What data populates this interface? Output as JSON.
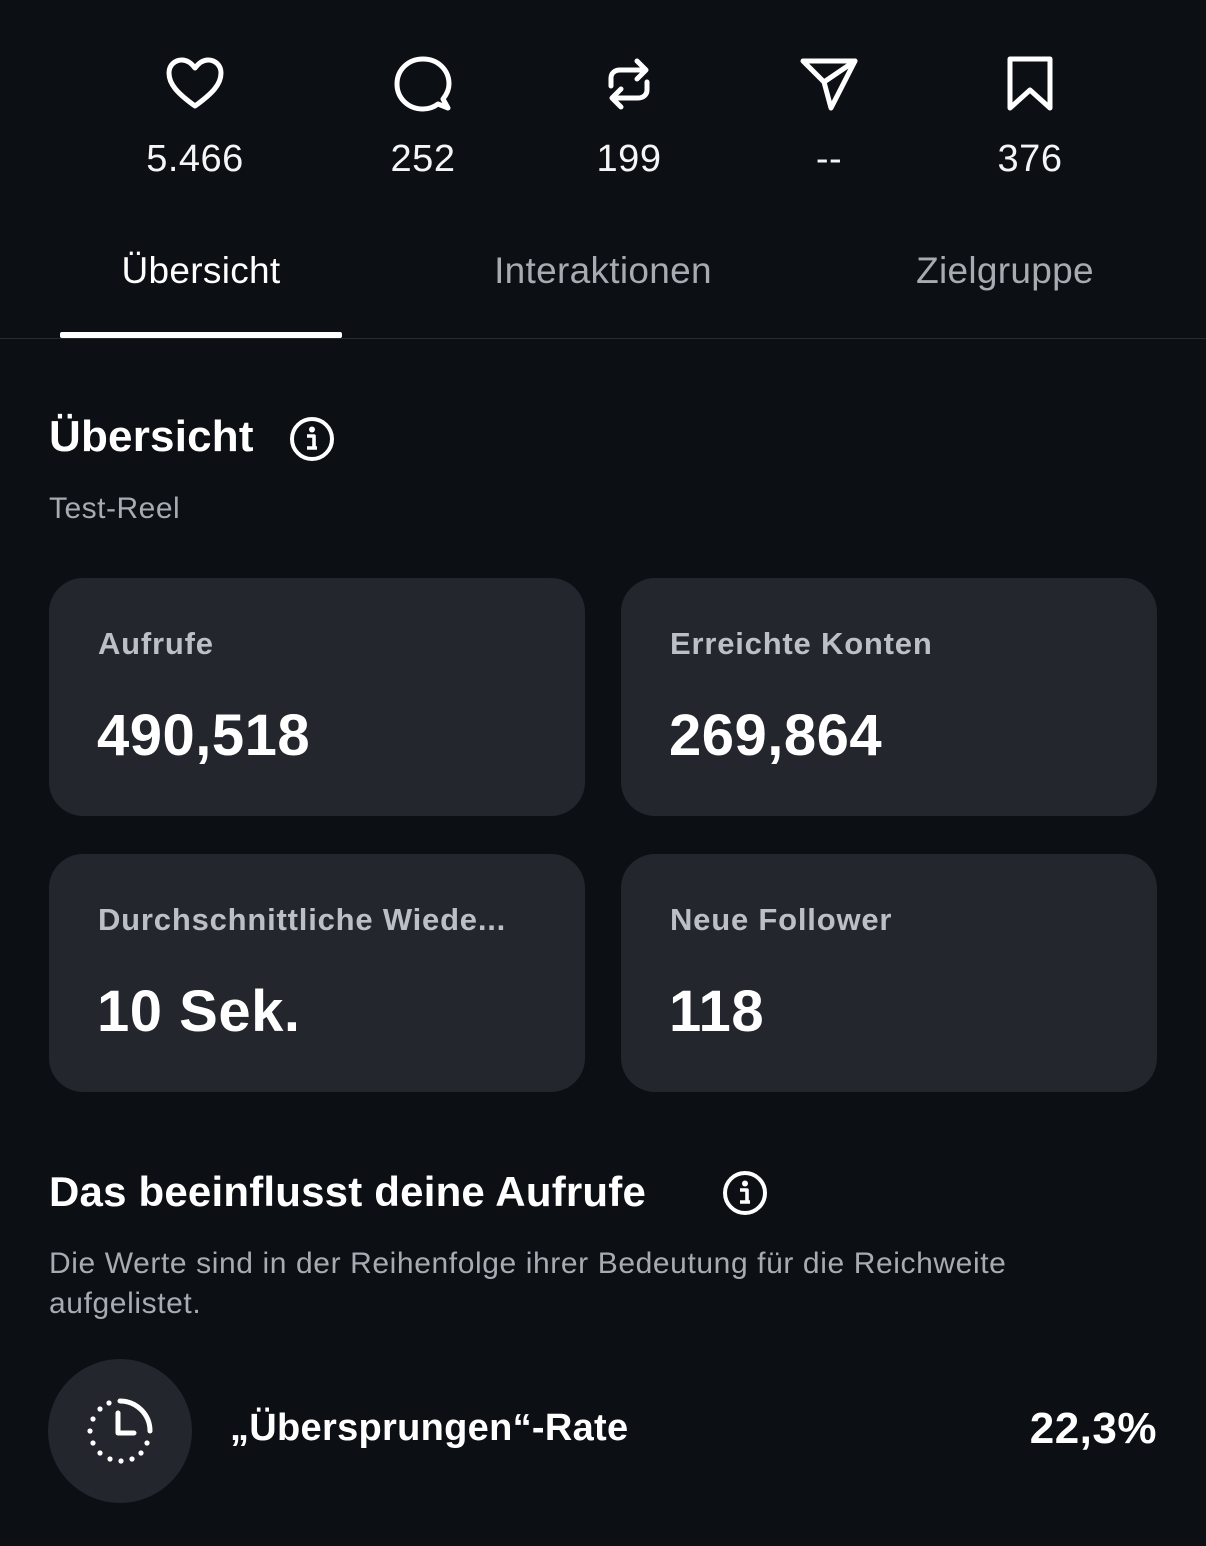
{
  "stats": [
    {
      "icon": "heart-icon",
      "value": "5.466"
    },
    {
      "icon": "comment-icon",
      "value": "252"
    },
    {
      "icon": "repost-icon",
      "value": "199"
    },
    {
      "icon": "share-icon",
      "value": "--"
    },
    {
      "icon": "bookmark-icon",
      "value": "376"
    }
  ],
  "tabs": [
    {
      "label": "Übersicht",
      "active": true
    },
    {
      "label": "Interaktionen",
      "active": false
    },
    {
      "label": "Zielgruppe",
      "active": false
    }
  ],
  "overview": {
    "title": "Übersicht",
    "subtitle": "Test-Reel",
    "cards": [
      {
        "label": "Aufrufe",
        "value": "490,518"
      },
      {
        "label": "Erreichte Konten",
        "value": "269,864"
      },
      {
        "label": "Durchschnittliche Wiede...",
        "value": "10 Sek."
      },
      {
        "label": "Neue Follower",
        "value": "118"
      }
    ]
  },
  "influence": {
    "title": "Das beeinflusst deine Aufrufe",
    "description": "Die Werte sind in der Reihenfolge ihrer Bedeutung für die Reichweite aufgelistet.",
    "items": [
      {
        "icon": "skip-timer-icon",
        "label": "„Übersprungen“-Rate",
        "value": "22,3%"
      }
    ]
  },
  "colors": {
    "background": "#0c0f14",
    "card": "#23262d",
    "muted_text": "#a7abb2"
  }
}
